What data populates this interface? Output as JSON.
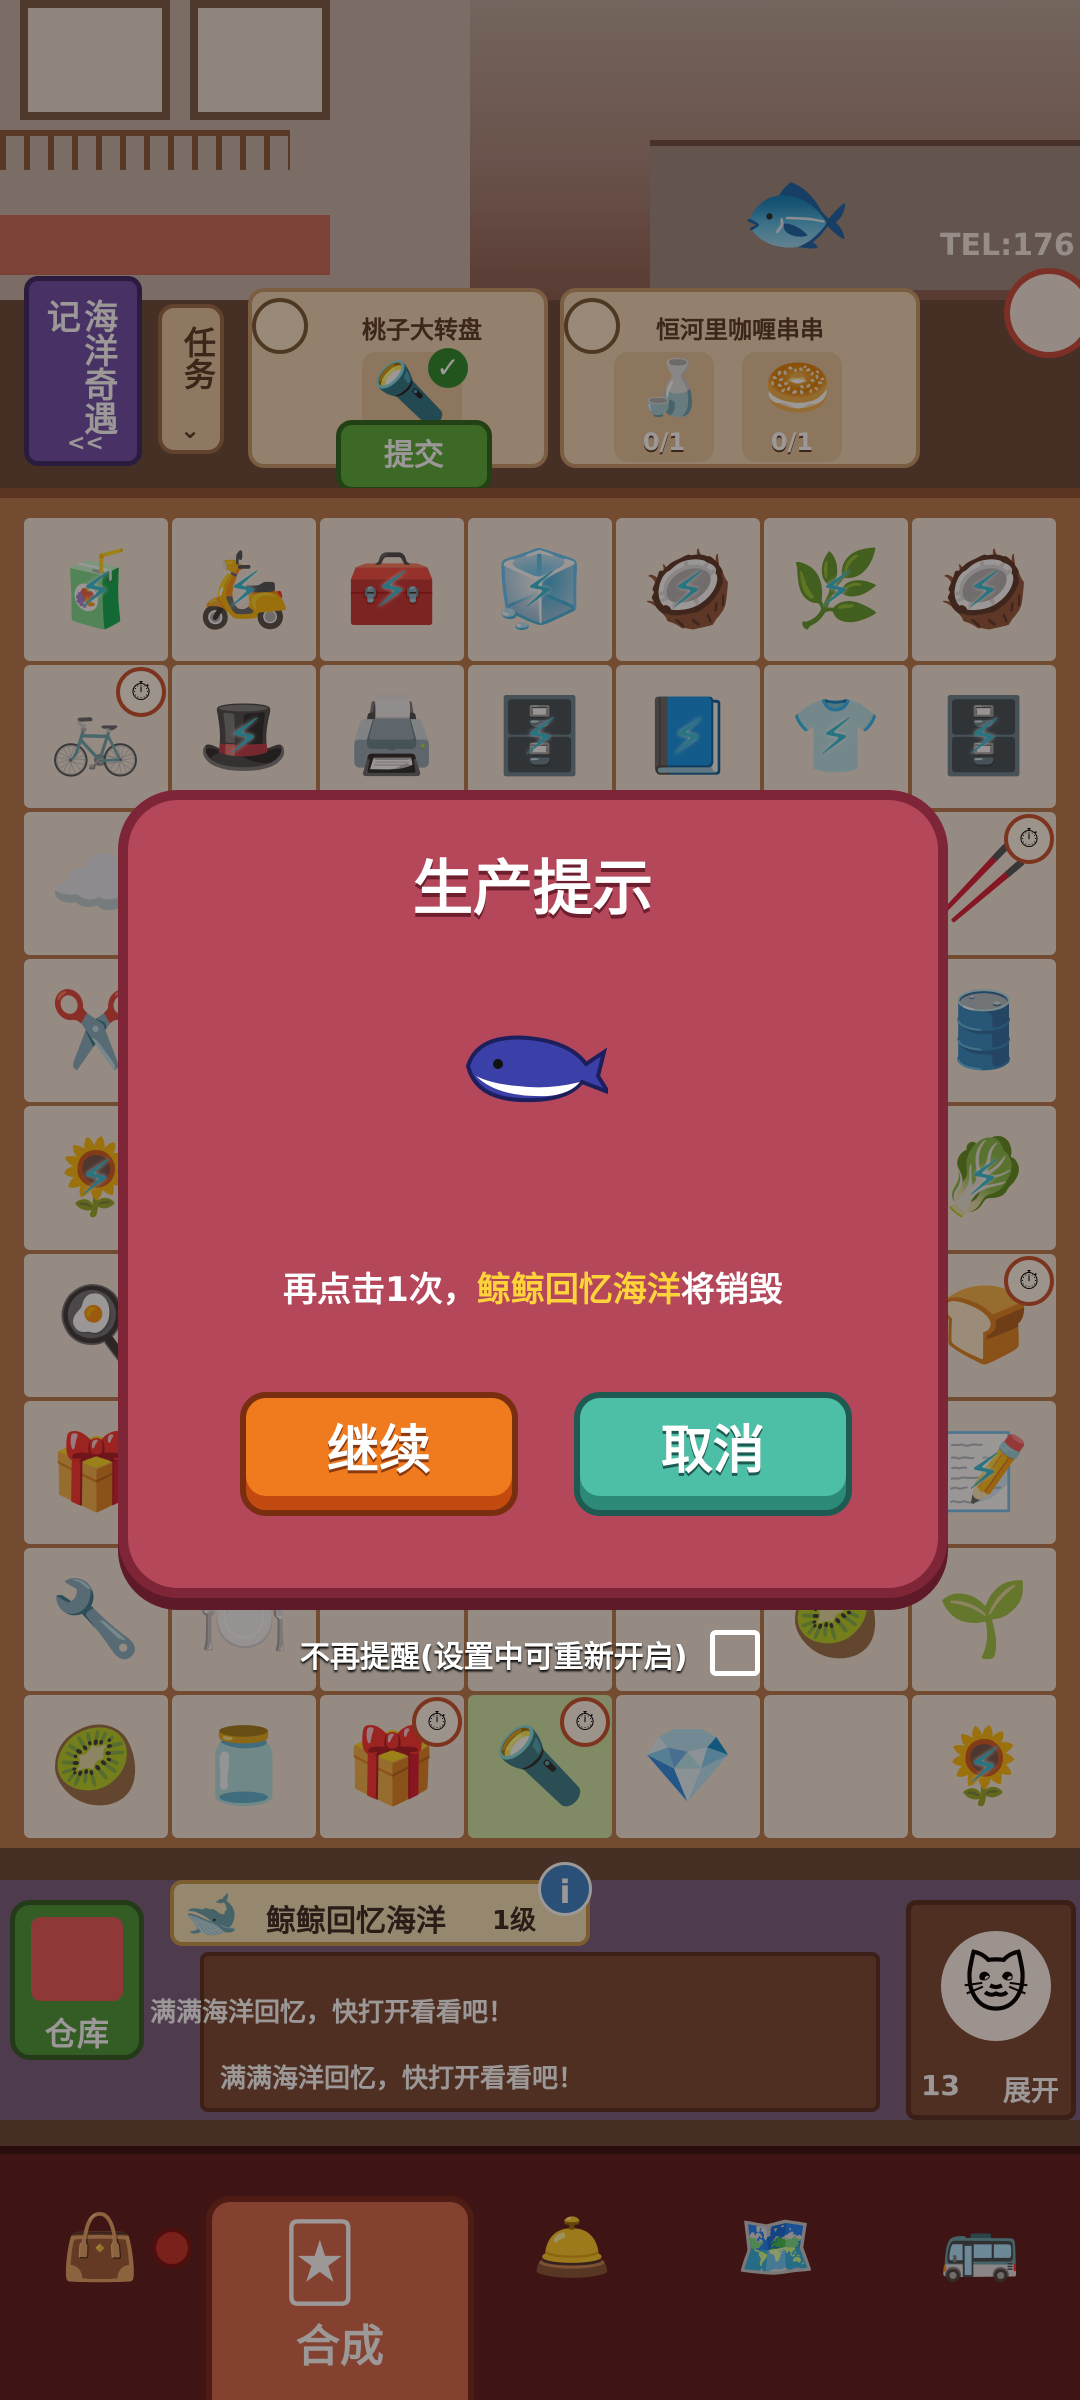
{
  "scene": {
    "tel_text": "TEL:176"
  },
  "hud": {
    "banner_label": "海洋奇遇记",
    "banner_arrow": "<<",
    "task_label": "任务",
    "order1": {
      "title": "桃子大转盘"
    },
    "order2": {
      "title": "恒河里咖喱串串",
      "slot1_count": "0/1",
      "slot2_count": "0/1"
    },
    "submit_label": "提交"
  },
  "board": {
    "rows": [
      [
        "🧃",
        "🛵",
        "🧰",
        "🧊",
        "🥥",
        "🌿",
        "🥥"
      ],
      [
        "🚲",
        "🎩",
        "🖨️",
        "🗄️",
        "📘",
        "👕",
        "🗄️"
      ],
      [
        "☁️",
        "",
        "",
        "",
        "",
        "",
        "🥢"
      ],
      [
        "✂️",
        "",
        "",
        "",
        "",
        "",
        "🛢️"
      ],
      [
        "🌻",
        "",
        "",
        "",
        "",
        "",
        "🥬"
      ],
      [
        "🍳",
        "",
        "",
        "",
        "",
        "",
        "🍞"
      ],
      [
        "🎁",
        "",
        "",
        "",
        "",
        "",
        "📝"
      ],
      [
        "🔧",
        "🍽️",
        "",
        "",
        "",
        "🥝",
        "🌱"
      ],
      [
        "🥝",
        "🫙",
        "🎁",
        "🔦",
        "💎",
        "",
        "🌻"
      ]
    ]
  },
  "modal": {
    "title": "生产提示",
    "message_prefix": "再点击1次，",
    "message_item": "鲸鲸回忆海洋",
    "message_suffix": "将销毁",
    "continue_label": "继续",
    "cancel_label": "取消",
    "no_remind_label": "不再提醒(设置中可重新开启)"
  },
  "info": {
    "warehouse_label": "仓库",
    "item_name": "鲸鲸回忆海洋",
    "item_level": "1级",
    "info_icon": "i",
    "desc_line1": "满满海洋回忆，快打开看看吧！",
    "desc_line2": "满满海洋回忆，快打开看看吧！",
    "count": "13",
    "expand_label": "展开"
  },
  "nav": {
    "merge_label": "合成"
  }
}
